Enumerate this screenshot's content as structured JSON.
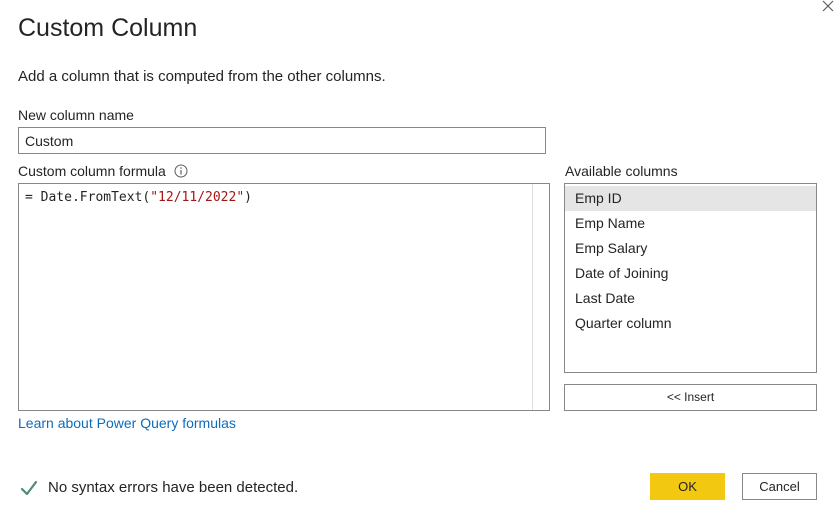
{
  "dialog": {
    "title": "Custom Column",
    "subtitle": "Add a column that is computed from the other columns.",
    "close_icon": "close-icon"
  },
  "new_column": {
    "label": "New column name",
    "value": "Custom"
  },
  "formula": {
    "label": "Custom column formula",
    "info_icon": "info-icon",
    "prefix": "= Date.FromText(",
    "string_literal": "\"12/11/2022\"",
    "suffix": ")"
  },
  "learn_link": "Learn about Power Query formulas",
  "available": {
    "label": "Available columns",
    "items": [
      {
        "label": "Emp ID",
        "selected": true
      },
      {
        "label": "Emp Name",
        "selected": false
      },
      {
        "label": "Emp Salary",
        "selected": false
      },
      {
        "label": "Date of Joining",
        "selected": false
      },
      {
        "label": "Last Date",
        "selected": false
      },
      {
        "label": "Quarter column",
        "selected": false
      }
    ]
  },
  "insert_label": "<< Insert",
  "status": {
    "icon": "check-icon",
    "text": "No syntax errors have been detected."
  },
  "buttons": {
    "ok": "OK",
    "cancel": "Cancel"
  },
  "colors": {
    "ok_bg": "#f2c811",
    "link": "#0f6cbd",
    "check": "#4f8a7a",
    "string_literal": "#a31515",
    "selected_row": "#e5e5e5"
  }
}
